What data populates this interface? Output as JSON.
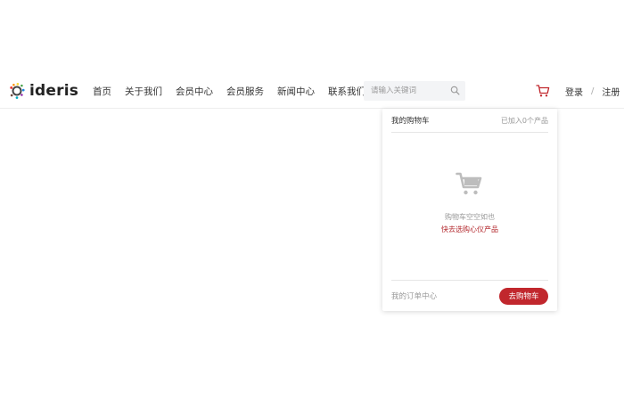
{
  "brand": {
    "name": "ideris",
    "icon": "ideris-logo-icon"
  },
  "nav": {
    "items": [
      {
        "label": "首页"
      },
      {
        "label": "关于我们"
      },
      {
        "label": "会员中心"
      },
      {
        "label": "会员服务"
      },
      {
        "label": "新闻中心"
      },
      {
        "label": "联系我们"
      }
    ]
  },
  "search": {
    "placeholder": "请输入关键词",
    "value": "",
    "icon": "search-icon"
  },
  "cart": {
    "icon": "shopping-cart-icon"
  },
  "auth": {
    "login": "登录",
    "separator": "/",
    "register": "注册"
  },
  "cart_panel": {
    "title": "我的购物车",
    "count_text": "已加入0个产品",
    "empty_icon": "empty-cart-icon",
    "empty_text": "购物车空空如也",
    "go_shop_link": "快去选购心仪产品",
    "orders_link": "我的订单中心",
    "go_cart_button": "去购物车"
  },
  "colors": {
    "accent": "#c1272d",
    "link": "#b3282d",
    "muted_text": "#999999",
    "search_bg": "#f3f4f6"
  }
}
